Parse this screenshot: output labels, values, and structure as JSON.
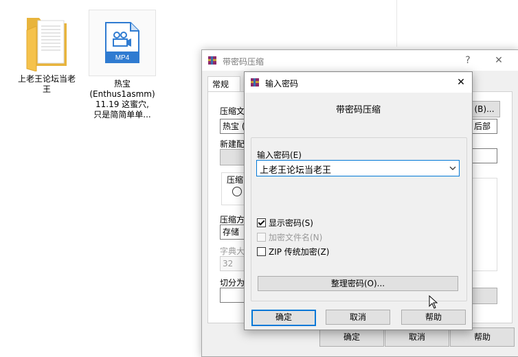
{
  "desktop": {
    "folder": {
      "label": "上老王论坛当老\n王"
    },
    "video": {
      "badge": "MP4",
      "label": "热宝\n(Enthus1asmm)\n11.19 这蜜穴,\n只是简简单单..."
    }
  },
  "bg_dialog": {
    "title": "带密码压缩",
    "help_glyph": "?",
    "close_glyph": "✕",
    "tab": "常规",
    "archive_name_label": "压缩文",
    "archive_name_value": "热宝 (",
    "browse_label": "(B)...",
    "update_mode_value": "后部",
    "new_config_label": "新建配",
    "format_label": "压缩",
    "method_label": "压缩方",
    "method_value": "存储",
    "dict_label": "字典大",
    "dict_value": "32",
    "split_label": "切分为",
    "ok": "确定",
    "cancel": "取消",
    "help": "帮助"
  },
  "fg_dialog": {
    "title": "输入密码",
    "close_glyph": "✕",
    "caption": "带密码压缩",
    "password_label": "输入密码(E)",
    "password_value": "上老王论坛当老王",
    "show_password": {
      "label": "显示密码(S)",
      "checked": true
    },
    "encrypt_names": {
      "label": "加密文件名(N)",
      "checked": false,
      "disabled": true
    },
    "zip_legacy": {
      "label": "ZIP 传统加密(Z)",
      "checked": false
    },
    "organize": "整理密码(O)...",
    "ok": "确定",
    "cancel": "取消",
    "help": "帮助"
  },
  "colors": {
    "accent": "#0078d7",
    "folder": "#f5c24c",
    "mp4_badge": "#2f7bd1"
  }
}
